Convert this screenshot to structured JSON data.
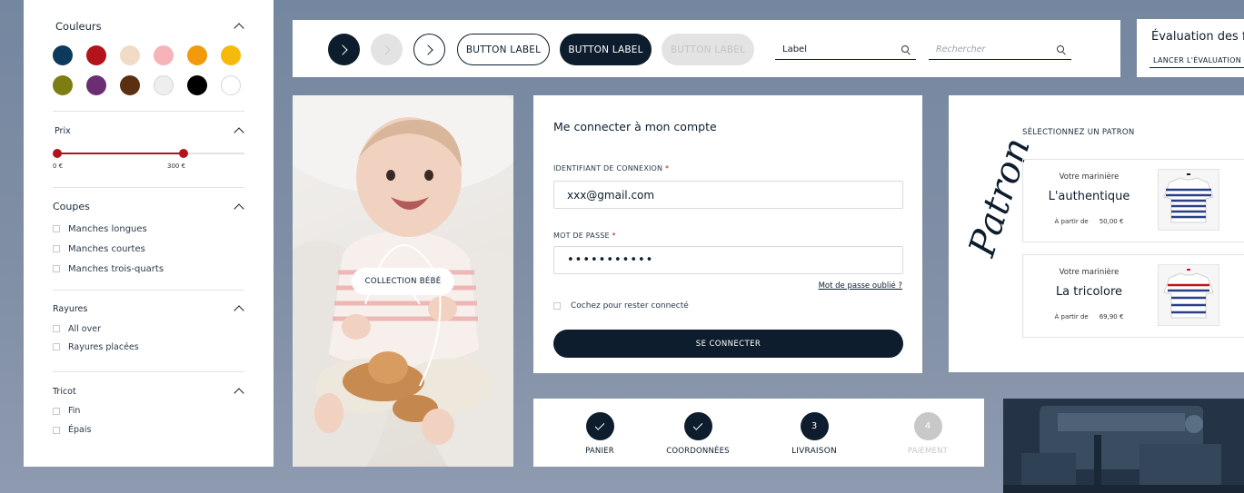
{
  "filters": {
    "colors": {
      "title": "Couleurs",
      "swatches": [
        "#0d3a5c",
        "#b3141b",
        "#f0dcc6",
        "#f6b3b8",
        "#f29a0c",
        "#f6ba0c",
        "#7d7d14",
        "#6b2e72",
        "#5a2f12",
        "#eeeeee",
        "#000000",
        "#ffffff"
      ]
    },
    "price": {
      "title": "Prix",
      "min_label": "0 €",
      "max_label": "300 €"
    },
    "cuts": {
      "title": "Coupes",
      "options": [
        "Manches longues",
        "Manches courtes",
        "Manches trois-quarts"
      ]
    },
    "stripes": {
      "title": "Rayures",
      "options": [
        "All over",
        "Rayures placées"
      ]
    },
    "knit": {
      "title": "Tricot",
      "options": [
        "Fin",
        "Épais"
      ]
    }
  },
  "toolbar": {
    "button_outline": "BUTTON LABEL",
    "button_primary": "BUTTON LABEL",
    "button_disabled": "BUTTON LABEL",
    "search1_value": "Label",
    "search2_placeholder": "Rechercher"
  },
  "evaluation": {
    "title": "Évaluation des fr",
    "link": "LANCER L'ÉVALUATION"
  },
  "hero": {
    "button": "COLLECTION BÉBÉ"
  },
  "login": {
    "title": "Me connecter à mon compte",
    "id_label": "IDENTIFIANT DE CONNEXION",
    "id_value": "xxx@gmail.com",
    "pwd_label": "MOT DE PASSE",
    "pwd_value": "•••••••••••",
    "required_mark": "*",
    "forgot": "Mot de passe oublié ?",
    "remember": "Cochez pour rester connecté",
    "submit": "SE CONNECTER"
  },
  "patron": {
    "script_text": "Patron",
    "heading": "SÉLECTIONNEZ UN PATRON",
    "items": [
      {
        "subtitle": "Votre marinière",
        "name": "L'authentique",
        "price_prefix": "À partir de",
        "price": "50,00 €"
      },
      {
        "subtitle": "Votre marinière",
        "name": "La tricolore",
        "price_prefix": "À partir de",
        "price": "69,90 €"
      }
    ]
  },
  "stepper": {
    "steps": [
      {
        "label": "PANIER",
        "state": "done",
        "number": ""
      },
      {
        "label": "COORDONNÉES",
        "state": "done",
        "number": ""
      },
      {
        "label": "LIVRAISON",
        "state": "current",
        "number": "3"
      },
      {
        "label": "PAIEMENT",
        "state": "upcoming",
        "number": "4"
      }
    ]
  },
  "colors": {
    "navy": "#0d1d2d",
    "red": "#b0141c",
    "disabled": "#e3e3e3"
  }
}
